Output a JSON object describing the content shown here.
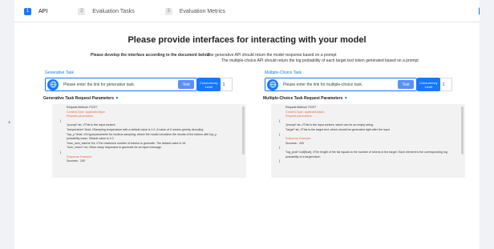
{
  "tabs": [
    {
      "num": "1",
      "label": "API",
      "active": true
    },
    {
      "num": "2",
      "label": "Evaluation Tasks",
      "active": false
    },
    {
      "num": "3",
      "label": "Evaluation Metrics",
      "active": false
    }
  ],
  "collapse_glyph": "‹",
  "heading": "Please provide interfaces for interacting with your model",
  "subheading": {
    "lead": "Please develop the interface according to the document below:",
    "line1": "The generative API should return the model response based on a prompt",
    "line2": "The multiple-choice API should return the log probability of each target text token generated based on a prompt"
  },
  "generative": {
    "title": "Generative Task",
    "placeholder": "Please enter the link for generative task.",
    "test_label": "Test",
    "concurrency_label": "Concurrency Level",
    "concurrency_value": "1",
    "params_title": "Generative Task Request Parameters",
    "code": {
      "method": "Request Method: POST",
      "content_type": "Content-Type:  application/json",
      "req_params": "Request parameters:",
      "open": "{",
      "l1": "\"prompt\":str, //This is the input content",
      "l2": "\"temperature\":float, //Sampling temperature with a default value is 1.0. A value of 0 means greedy decoding",
      "l3": "\"top_p\":float, //A hyperparameter for nucleus sampling, where the model considers the results of the tokens with top_p probability mass. Default value is 1.0",
      "l4": "\"max_new_tokens\":int, //The maximum number of tokens to generate. The default value is 16.",
      "l5": "\"num_return\":int, //How many responses to generate for an input message.",
      "close": "}",
      "resp": "Response Example:",
      "success": "Success：200"
    }
  },
  "multiple_choice": {
    "title": "Multiple-Choice Task",
    "placeholder": "Please enter the link for multiple-choice task.",
    "test_label": "Test",
    "concurrency_label": "Concurrency Level",
    "concurrency_value": "1",
    "params_title": "Multiple-Choice Task Request Parameters",
    "code": {
      "method": "Request Method: POST",
      "content_type": "Content-Type:  application/json",
      "req_params": "Request parameters:",
      "open": "{",
      "l1": "\"prompt\":str, //This is the input content, which can be an empty string.",
      "l2": "\"target\":str, //This is the target text, which should be generated right after the input",
      "close": "}",
      "resp": "Response Example:",
      "success": "Success：200",
      "open2": "{",
      "l3": "\"log_prob\":List[float], //The length of the list equals to the number of tokens in the target. Each element is the corresponding log probability of a target token",
      "close2": "}"
    }
  },
  "colors": {
    "accent": "#1677ff",
    "test_button": "#5b8ff9",
    "code_bg": "#f2f2f2",
    "highlight": "#e8684a"
  }
}
